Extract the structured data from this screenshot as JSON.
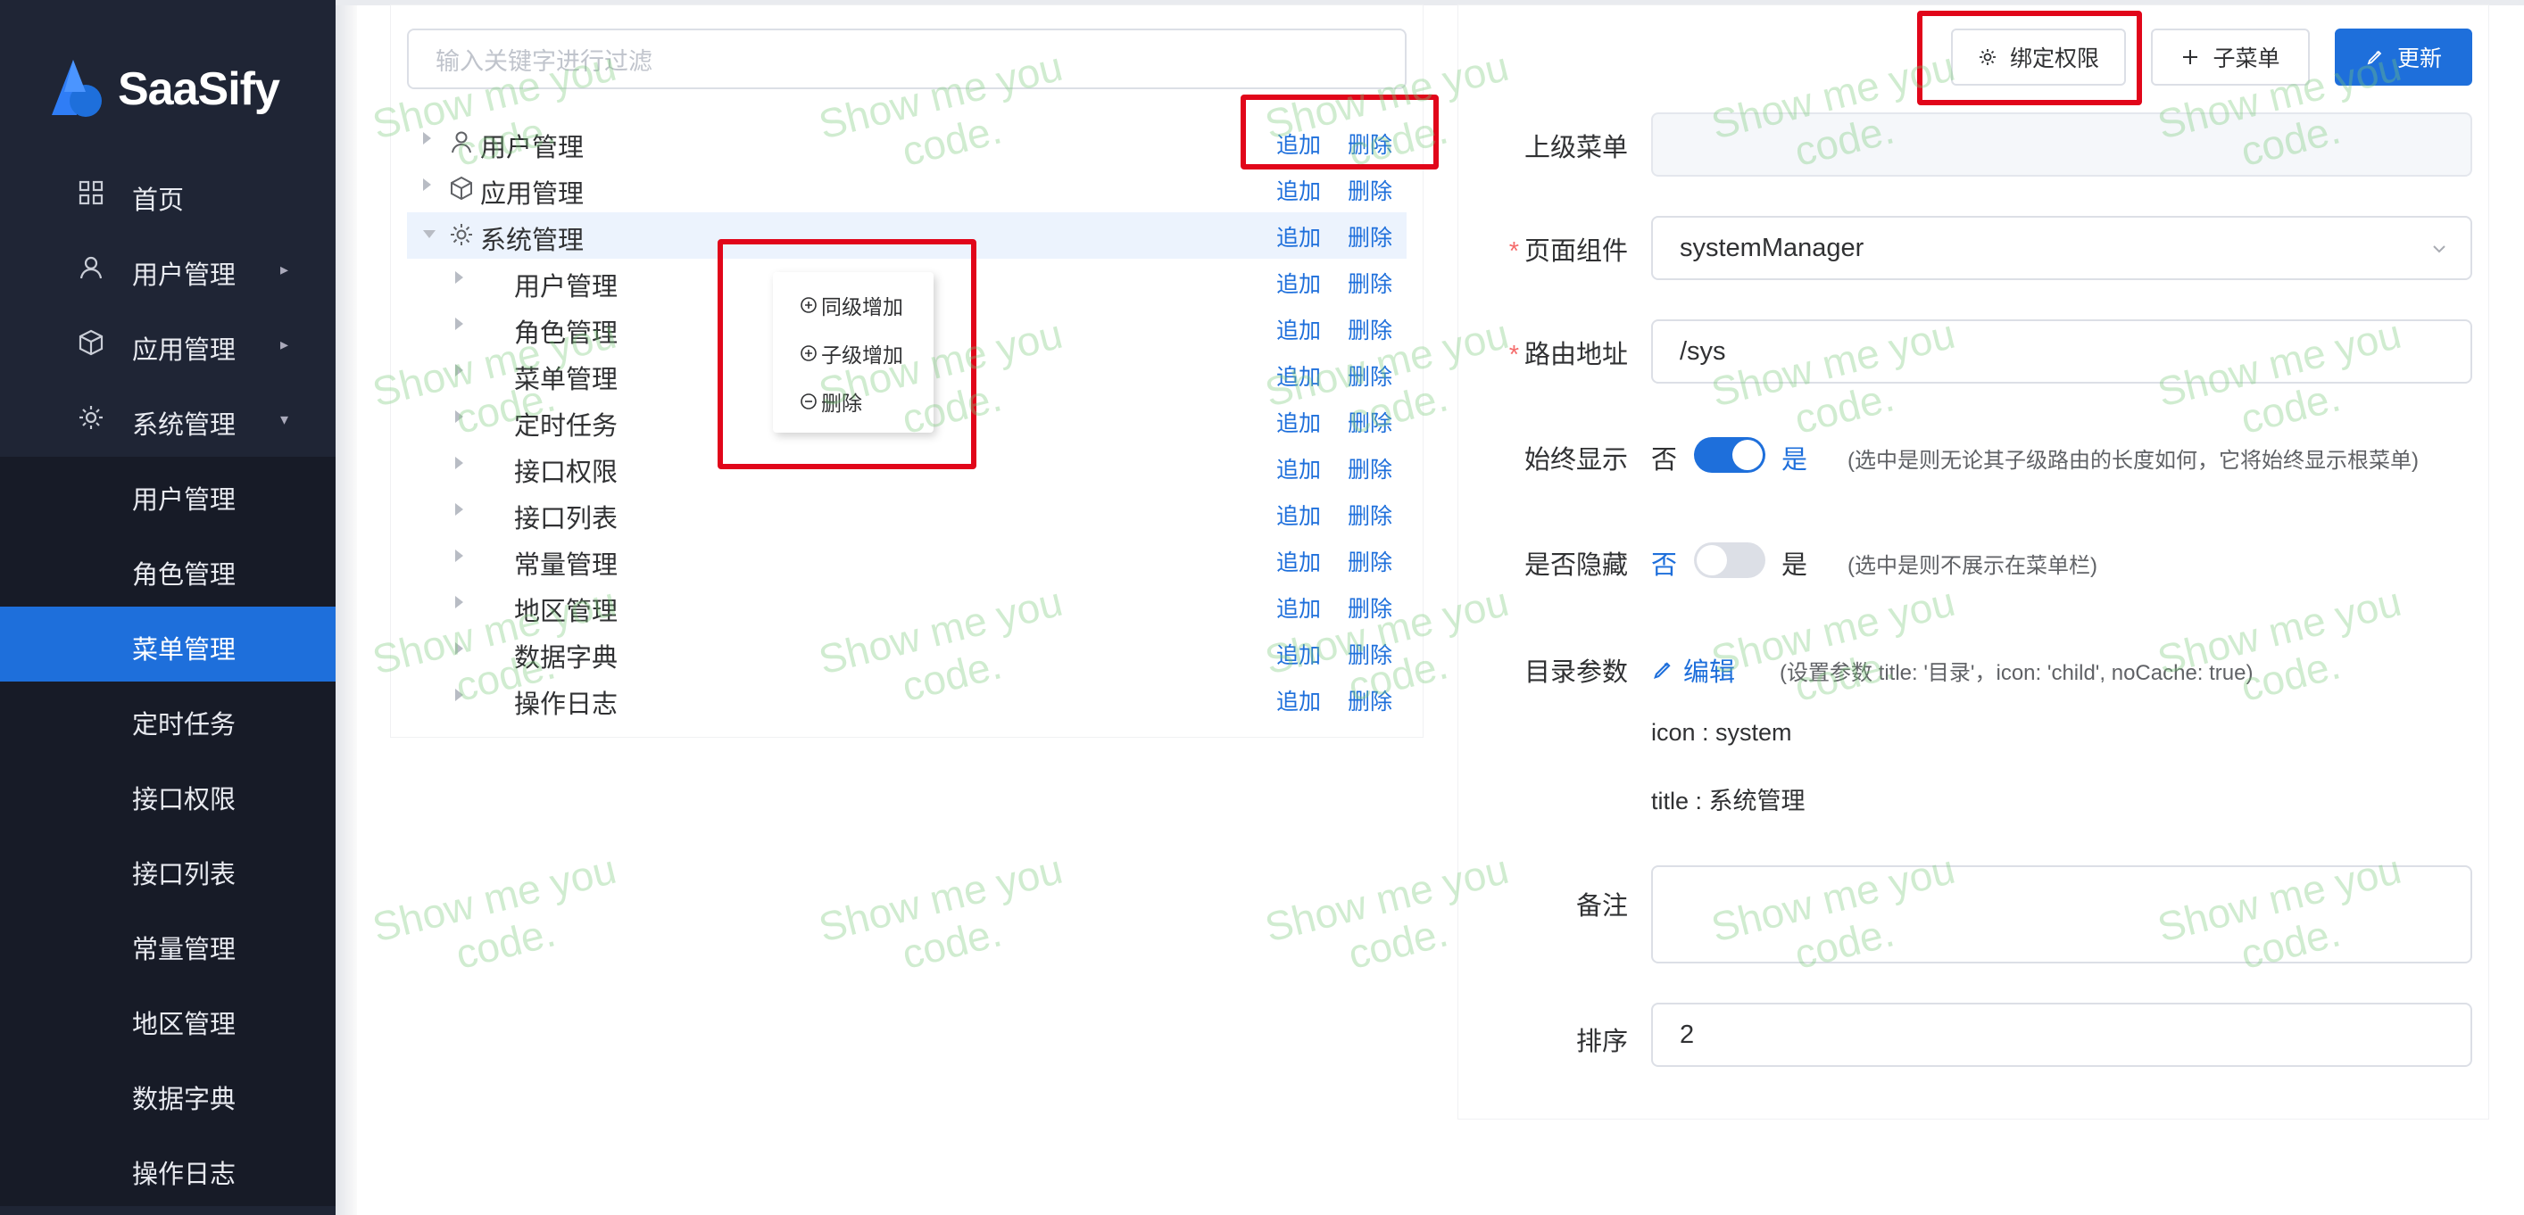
{
  "app": {
    "logo_text": "SaaSify"
  },
  "sidebar": {
    "items": [
      {
        "label": "首页",
        "icon": "grid-icon"
      },
      {
        "label": "用户管理",
        "icon": "user-icon",
        "arrow": "▸"
      },
      {
        "label": "应用管理",
        "icon": "cube-icon",
        "arrow": "▸"
      },
      {
        "label": "系统管理",
        "icon": "gear-icon",
        "arrow": "▾"
      }
    ],
    "subitems": [
      {
        "label": "用户管理"
      },
      {
        "label": "角色管理"
      },
      {
        "label": "菜单管理",
        "active": true
      },
      {
        "label": "定时任务"
      },
      {
        "label": "接口权限"
      },
      {
        "label": "接口列表"
      },
      {
        "label": "常量管理"
      },
      {
        "label": "地区管理"
      },
      {
        "label": "数据字典"
      },
      {
        "label": "操作日志"
      }
    ]
  },
  "tree": {
    "filter_placeholder": "输入关键字进行过滤",
    "add_label": "追加",
    "delete_label": "删除",
    "nodes": [
      {
        "label": "用户管理",
        "icon": "user-icon",
        "level": 0
      },
      {
        "label": "应用管理",
        "icon": "cube-icon",
        "level": 0
      },
      {
        "label": "系统管理",
        "icon": "gear-icon",
        "level": 0,
        "expanded": true
      },
      {
        "label": "用户管理",
        "level": 1
      },
      {
        "label": "角色管理",
        "level": 1
      },
      {
        "label": "菜单管理",
        "level": 1
      },
      {
        "label": "定时任务",
        "level": 1
      },
      {
        "label": "接口权限",
        "level": 1
      },
      {
        "label": "接口列表",
        "level": 1
      },
      {
        "label": "常量管理",
        "level": 1
      },
      {
        "label": "地区管理",
        "level": 1
      },
      {
        "label": "数据字典",
        "level": 1
      },
      {
        "label": "操作日志",
        "level": 1
      }
    ]
  },
  "context_menu": {
    "items": [
      {
        "label": "同级增加",
        "icon": "plus-circle-icon"
      },
      {
        "label": "子级增加",
        "icon": "plus-circle-icon"
      },
      {
        "label": "删除",
        "icon": "minus-circle-icon"
      }
    ]
  },
  "toolbar": {
    "bind_permission_label": "绑定权限",
    "submenu_label": "子菜单",
    "update_label": "更新"
  },
  "form": {
    "parent_menu_label": "上级菜单",
    "parent_menu_value": "",
    "component_label": "页面组件",
    "component_value": "systemManager",
    "route_label": "路由地址",
    "route_value": "/sys",
    "always_show_label": "始终显示",
    "always_show_no": "否",
    "always_show_yes": "是",
    "always_show_on": true,
    "always_show_hint": "(选中是则无论其子级路由的长度如何，它将始终显示根菜单)",
    "hidden_label": "是否隐藏",
    "hidden_no": "否",
    "hidden_yes": "是",
    "hidden_on": false,
    "hidden_hint": "(选中是则不展示在菜单栏)",
    "meta_label": "目录参数",
    "meta_edit_label": "编辑",
    "meta_hint": "(设置参数 title: '目录'，icon: 'child', noCache: true)",
    "meta_icon_line": "icon : system",
    "meta_title_line": "title : 系统管理",
    "remark_label": "备注",
    "remark_value": "",
    "sort_label": "排序",
    "sort_value": "2"
  },
  "watermark": {
    "line1": "Show me you",
    "line2": "code."
  },
  "colors": {
    "primary": "#1e6fdb",
    "sidebar": "#1f2535",
    "annotation": "#e1061a"
  }
}
